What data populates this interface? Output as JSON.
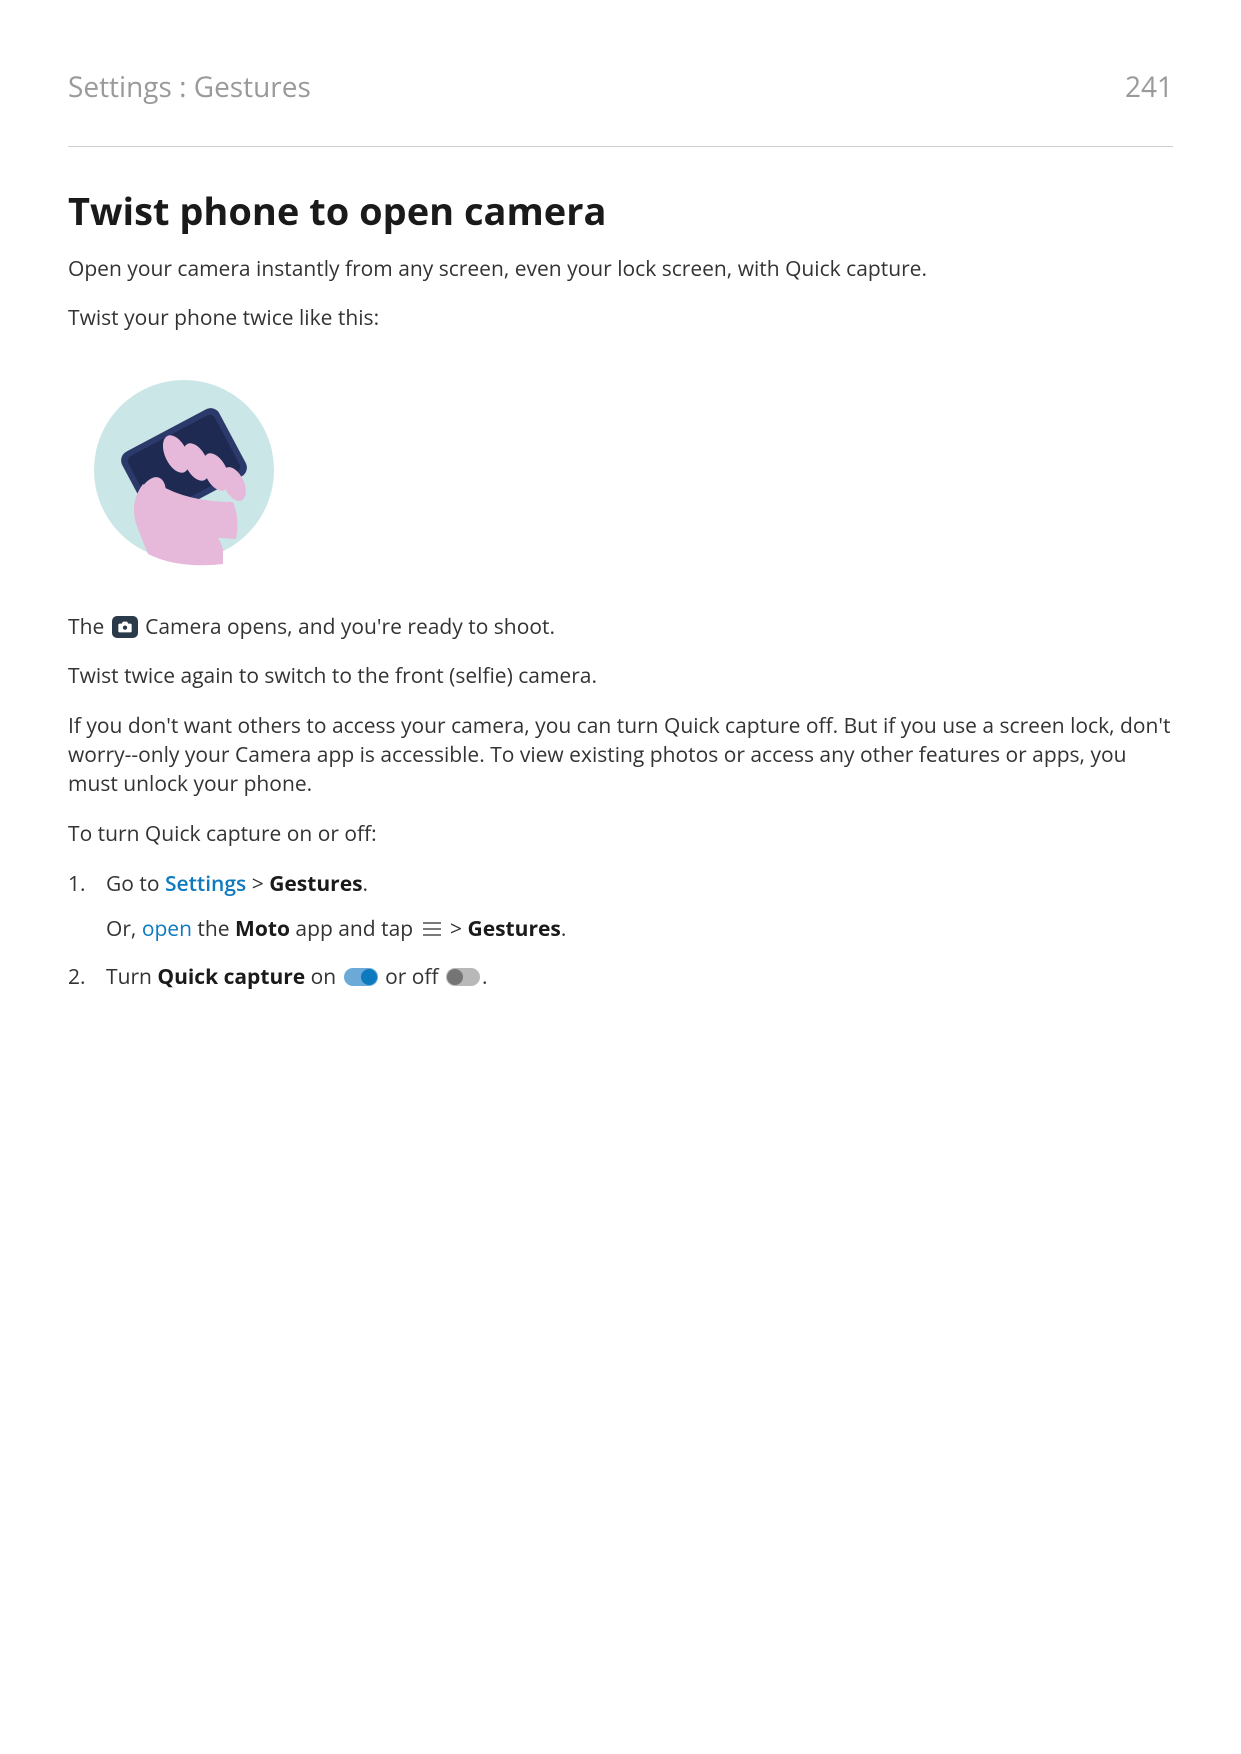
{
  "header": {
    "breadcrumb": "Settings : Gestures",
    "page_number": "241"
  },
  "title": "Twist phone to open camera",
  "para_intro": "Open your camera instantly from any screen, even your lock screen, with Quick capture.",
  "para_twist": "Twist your phone twice like this:",
  "camera_line": {
    "prefix": "The ",
    "icon": "camera-icon",
    "suffix": " Camera opens, and you're ready to shoot."
  },
  "para_switch": "Twist twice again to switch to the front (selfie) camera.",
  "para_access": "If you don't want others to access your camera, you can turn Quick capture off. But if you use a screen lock, don't worry--only your Camera app is accessible. To view existing photos or access any other features or apps, you must unlock your phone.",
  "para_toturn": "To turn Quick capture on or off:",
  "steps": {
    "s1": {
      "goto": "Go to ",
      "settings_link": "Settings",
      "sep": " > ",
      "gestures": "Gestures",
      "period": ".",
      "or_prefix": "Or, ",
      "open_link": "open",
      "or_mid1": " the ",
      "moto": "Moto",
      "or_mid2": " app and tap ",
      "menu_icon": "menu-icon",
      "or_sep": " > ",
      "gestures2": "Gestures",
      "period2": "."
    },
    "s2": {
      "prefix": "Turn ",
      "quickcapture": "Quick capture",
      "on_text": " on ",
      "toggle_on": "toggle-on",
      "mid": " or off ",
      "toggle_off": "toggle-off",
      "period": "."
    }
  }
}
